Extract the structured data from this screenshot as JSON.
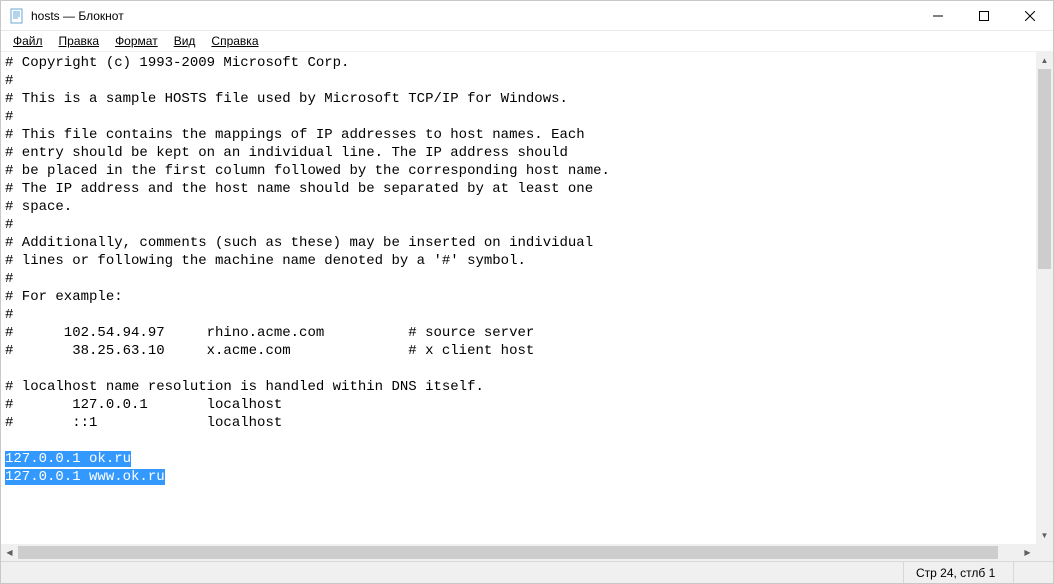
{
  "window": {
    "title": "hosts — Блокнот"
  },
  "menu": {
    "file": "Файл",
    "edit": "Правка",
    "format": "Формат",
    "view": "Вид",
    "help": "Справка"
  },
  "content": {
    "lines": [
      "# Copyright (c) 1993-2009 Microsoft Corp.",
      "#",
      "# This is a sample HOSTS file used by Microsoft TCP/IP for Windows.",
      "#",
      "# This file contains the mappings of IP addresses to host names. Each",
      "# entry should be kept on an individual line. The IP address should",
      "# be placed in the first column followed by the corresponding host name.",
      "# The IP address and the host name should be separated by at least one",
      "# space.",
      "#",
      "# Additionally, comments (such as these) may be inserted on individual",
      "# lines or following the machine name denoted by a '#' symbol.",
      "#",
      "# For example:",
      "#",
      "#      102.54.94.97     rhino.acme.com          # source server",
      "#       38.25.63.10     x.acme.com              # x client host",
      "",
      "# localhost name resolution is handled within DNS itself.",
      "#       127.0.0.1       localhost",
      "#       ::1             localhost",
      ""
    ],
    "selected_lines": [
      "127.0.0.1 ok.ru",
      "127.0.0.1 www.ok.ru"
    ]
  },
  "status": {
    "position": "Стр 24, стлб 1"
  }
}
